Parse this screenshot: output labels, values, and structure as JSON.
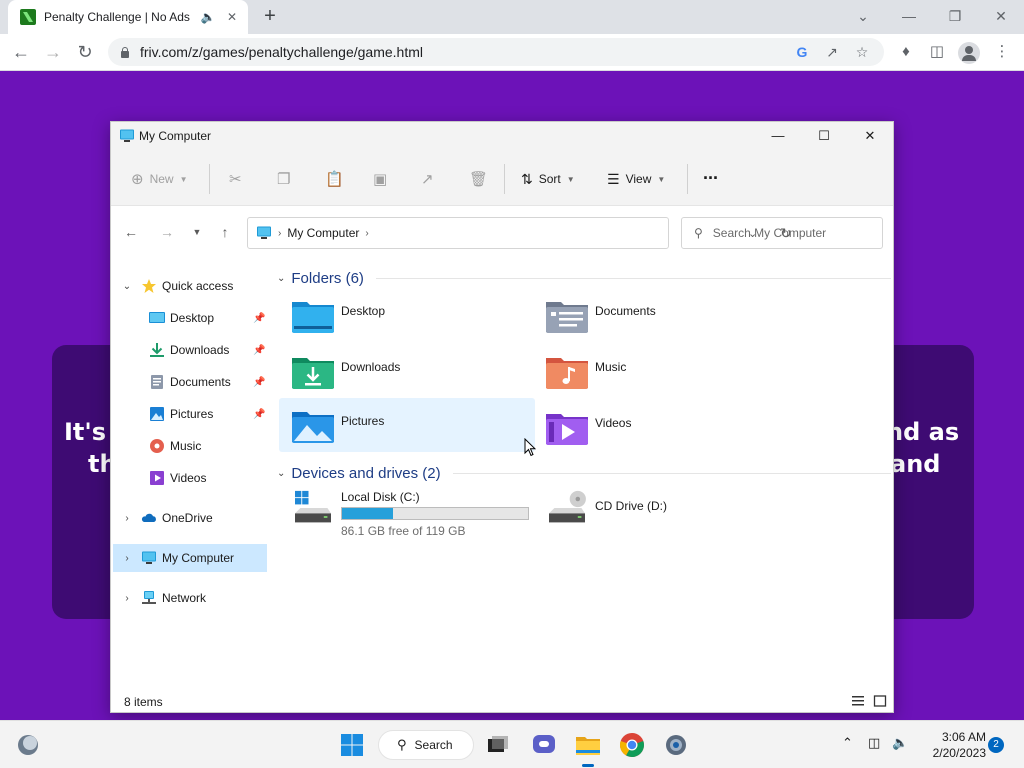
{
  "browser": {
    "tab_title": "Penalty Challenge | No Ads |",
    "url": "friv.com/z/games/penaltychallenge/game.html"
  },
  "game": {
    "text_left_line1": "It's",
    "text_left_line2": "th",
    "text_right_line1": "nd as",
    "text_right_line2": "and"
  },
  "explorer": {
    "title": "My Computer",
    "commands": {
      "new": "New",
      "sort": "Sort",
      "view": "View",
      "more": "..."
    },
    "address": {
      "location": "My Computer",
      "search_placeholder": "Search My Computer"
    },
    "nav": {
      "quick_access": "Quick access",
      "items": [
        {
          "label": "Desktop",
          "pinned": true
        },
        {
          "label": "Downloads",
          "pinned": true
        },
        {
          "label": "Documents",
          "pinned": true
        },
        {
          "label": "Pictures",
          "pinned": true
        },
        {
          "label": "Music",
          "pinned": false
        },
        {
          "label": "Videos",
          "pinned": false
        }
      ],
      "onedrive": "OneDrive",
      "my_computer": "My Computer",
      "network": "Network"
    },
    "folders_header": "Folders (6)",
    "folders": [
      {
        "label": "Desktop"
      },
      {
        "label": "Documents"
      },
      {
        "label": "Downloads"
      },
      {
        "label": "Music"
      },
      {
        "label": "Pictures"
      },
      {
        "label": "Videos"
      }
    ],
    "drives_header": "Devices and drives (2)",
    "drives": {
      "c_label": "Local Disk (C:)",
      "c_free": "86.1 GB free of 119 GB",
      "c_used_fraction": 0.276,
      "d_label": "CD Drive (D:)"
    },
    "status": "8 items"
  },
  "taskbar": {
    "search_label": "Search",
    "time": "3:06 AM",
    "date": "2/20/2023",
    "notification_count": "2"
  }
}
